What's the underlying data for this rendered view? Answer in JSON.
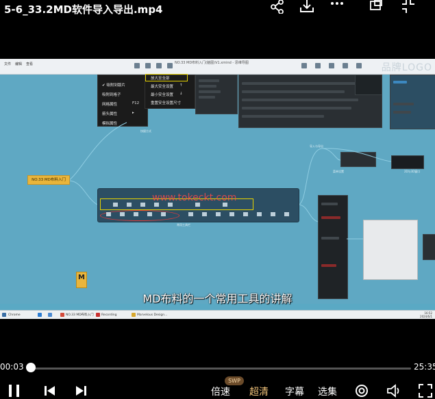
{
  "header": {
    "title": "5-6_33.2MD软件导入导出.mp4",
    "icons": [
      "share-icon",
      "download-icon",
      "more-icon",
      "pip-icon",
      "fullscreen-exit-icon"
    ]
  },
  "video": {
    "window_title": "NO.33 MD布料入门(脑图)V1.xmind - 思维导图",
    "brand": "品牌LOGO",
    "menu": [
      "文件",
      "编辑",
      "查看"
    ],
    "context_menu_left": [
      {
        "label": "✔ 吸附到版片",
        "key": ""
      },
      {
        "label": "吸附到格子",
        "key": ""
      },
      {
        "label": "网格属性",
        "key": "F12"
      },
      {
        "label": "箭头属性",
        "key": "▸"
      },
      {
        "label": "模拟属性",
        "key": ""
      }
    ],
    "context_menu_right": [
      {
        "label": "放大至全部",
        "key": ""
      },
      {
        "label": "最大安全设置",
        "key": "↑"
      },
      {
        "label": "最小安全设置",
        "key": "↓"
      },
      {
        "label": "重置安全设置尺寸",
        "key": ""
      }
    ],
    "yellow_node": "NO.33 MD布料入门",
    "watermark": "www.tokeckt.com",
    "subtitle": "MD布料的一个常用工具的讲解",
    "md_logo": "M",
    "node_labels": {
      "a": "快捷方式",
      "b": "常用工具栏",
      "c": "导入与导出",
      "d": "菜单设置",
      "e": "2D与3D窗口"
    },
    "taskbar": {
      "items": [
        "Chrome",
        "NO.33 MD布料入门",
        "Recording",
        "Marvelous Design..."
      ],
      "clock_time": "16:52",
      "clock_date": "2024/6/1"
    }
  },
  "player": {
    "current_time": "00:03",
    "total_time": "25:35",
    "progress": 0.002,
    "buttons": {
      "speed": "倍速",
      "quality": "超清",
      "subtitles": "字幕",
      "episodes": "选集",
      "swp_badge": "SWP"
    }
  }
}
